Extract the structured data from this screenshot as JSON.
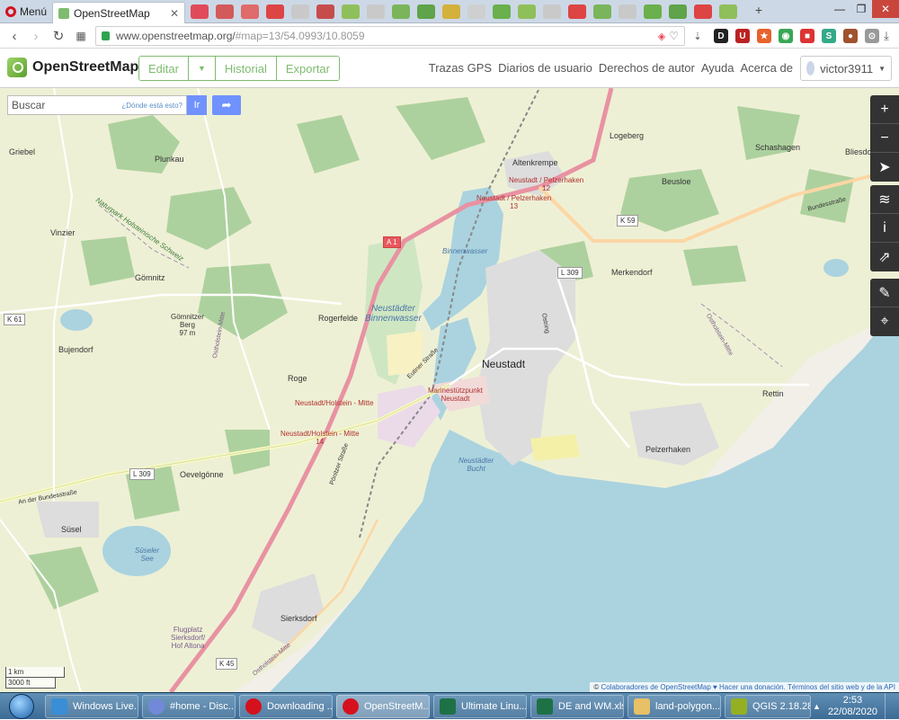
{
  "browser": {
    "menu_label": "Menú",
    "tab_title": "OpenStreetMap",
    "url_host": "www.openstreetmap.org/",
    "url_path": "#map=13/54.0993/10.8059",
    "window_controls": [
      "minimize-icon",
      "restore-icon",
      "close-icon"
    ]
  },
  "header": {
    "logo_text": "OpenStreetMap",
    "edit_label": "Editar",
    "history_label": "Historial",
    "export_label": "Exportar",
    "links": [
      "Trazas GPS",
      "Diarios de usuario",
      "Derechos de autor",
      "Ayuda",
      "Acerca de"
    ],
    "username": "victor3911"
  },
  "search": {
    "placeholder": "Buscar",
    "where_link": "¿Dónde está esto?",
    "go_label": "Ir"
  },
  "map": {
    "towns": [
      {
        "name": "Neustadt"
      },
      {
        "name": "Altenkrempe"
      },
      {
        "name": "Logeberg"
      },
      {
        "name": "Schashagen"
      },
      {
        "name": "Bliesdorf"
      },
      {
        "name": "Beusloe"
      },
      {
        "name": "Merkendorf"
      },
      {
        "name": "Griebel"
      },
      {
        "name": "Plunkau"
      },
      {
        "name": "Vinzier"
      },
      {
        "name": "Gömnitz"
      },
      {
        "name": "Bujendorf"
      },
      {
        "name": "Rogerfelde"
      },
      {
        "name": "Roge"
      },
      {
        "name": "Rettin"
      },
      {
        "name": "Pelzerhaken"
      },
      {
        "name": "Oevelgönne"
      },
      {
        "name": "Süsel"
      },
      {
        "name": "Sierksdorf"
      }
    ],
    "labels": {
      "gomnitzer_berg": "Gömnitzer\nBerg\n97 m",
      "binnenwasser": "Neustädter\nBinnenwasser",
      "binnenwasser_small": "Binnenwasser",
      "bucht": "Neustädter\nBucht",
      "suseler_see": "Süseler\nSee",
      "naturpark": "Naturpark Holsteinische Schweiz",
      "marine": "Marinestützpunkt\nNeustadt",
      "station_1": "Neustadt/Holstein - Mitte",
      "station_2": "Neustadt/Holstein - Mitte\n14",
      "station_3": "Neustadt / Pelzerhaken\n13",
      "station_4": "Neustadt / Pelzerhaken\n12",
      "flugplatz": "Flugplatz\nSierksdorf/\nHof Altona",
      "eutiner": "Eutiner Straße",
      "bundesstrasse": "Bundesstraße",
      "ostholstein": "Ostholstein-Mitte",
      "ostholstein_2": "Ostholstein-Mitte",
      "ostholstein_3": "Ostholstein-Mitte",
      "am_bundes": "An der Bundesstraße",
      "paradies": "Pönitzer Straße",
      "ostring": "Ostring"
    },
    "shields": {
      "a1": "A 1",
      "l309_a": "L 309",
      "l309_b": "L 309",
      "k59": "K 59",
      "k61": "K 61",
      "k45": "K 45"
    },
    "scale_km": "1 km",
    "scale_ft": "3000 ft",
    "attribution_prefix": "©",
    "attribution_link": "Colaboradores de OpenStreetMap",
    "attribution_donate": "♥ Hacer una donación.",
    "attribution_terms": "Términos del sitio web y de la API"
  },
  "controls": [
    "zoom-in",
    "zoom-out",
    "locate",
    "layers",
    "info",
    "share",
    "note",
    "query"
  ],
  "taskbar": {
    "items": [
      "Windows Live...",
      "#home - Disc...",
      "Downloading ...",
      "OpenStreetM...",
      "Ultimate Linu...",
      "DE and WM.xls",
      "land-polygon...",
      "QGIS 2.18.28"
    ],
    "time": "2:53",
    "date": "22/08/2020"
  },
  "colors": {
    "osm_green": "#7ebc6f",
    "search_blue": "#7092ff",
    "water": "#aad3df",
    "forest": "#add19e",
    "motorway": "#e892a2"
  }
}
